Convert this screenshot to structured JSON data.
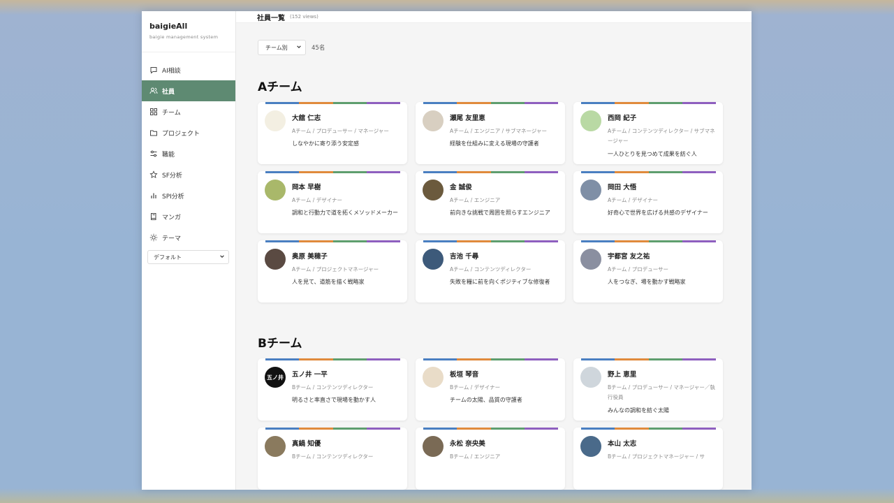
{
  "app": {
    "name": "baigieAll",
    "subtitle": "baigie management system"
  },
  "sidebar": {
    "items": [
      {
        "label": "AI相談",
        "icon": "chat-icon",
        "active": false
      },
      {
        "label": "社員",
        "icon": "users-icon",
        "active": true
      },
      {
        "label": "チーム",
        "icon": "grid-icon",
        "active": false
      },
      {
        "label": "プロジェクト",
        "icon": "folder-icon",
        "active": false
      },
      {
        "label": "職能",
        "icon": "sliders-icon",
        "active": false
      },
      {
        "label": "SF分析",
        "icon": "star-icon",
        "active": false
      },
      {
        "label": "SPI分析",
        "icon": "bar-chart-icon",
        "active": false
      },
      {
        "label": "マンガ",
        "icon": "book-icon",
        "active": false
      },
      {
        "label": "テーマ",
        "icon": "sun-icon",
        "active": false
      }
    ],
    "theme_value": "デフォルト"
  },
  "header": {
    "title": "社員一覧",
    "views": "(152 views)"
  },
  "filter": {
    "selected": "チーム別",
    "count": "45名"
  },
  "stripe_colors": [
    "#4a7fc1",
    "#e08a3c",
    "#5e9e6e",
    "#8e5fbf"
  ],
  "teams": [
    {
      "title": "Aチーム",
      "members": [
        {
          "name": "大舘 仁志",
          "role": "Aチーム / プロデューサー / マネージャー",
          "desc": "しなやかに寄り添う安定感",
          "avatar_color": "#f3efe2"
        },
        {
          "name": "瀬尾 友里恵",
          "role": "Aチーム / エンジニア / サブマネージャー",
          "desc": "経験を仕組みに変える現場の守護者",
          "avatar_color": "#d8cfc1"
        },
        {
          "name": "西岡 紀子",
          "role": "Aチーム / コンテンツディレクター / サブマネージャー",
          "desc": "一人ひとりを見つめて成果を紡ぐ人",
          "avatar_color": "#b9d9a4"
        },
        {
          "name": "岡本 早樹",
          "role": "Aチーム / デザイナー",
          "desc": "調和と行動力で道を拓くメソッドメーカー",
          "avatar_color": "#a9b86a"
        },
        {
          "name": "金 誠俊",
          "role": "Aチーム / エンジニア",
          "desc": "前向きな挑戦で周囲を照らすエンジニア",
          "avatar_color": "#6b5a3d"
        },
        {
          "name": "岡田 大悟",
          "role": "Aチーム / デザイナー",
          "desc": "好奇心で世界を広げる共感のデザイナー",
          "avatar_color": "#7f8fa6"
        },
        {
          "name": "奥原 美穂子",
          "role": "Aチーム / プロジェクトマネージャー",
          "desc": "人を見て、道筋を描く戦略家",
          "avatar_color": "#5a4a42"
        },
        {
          "name": "吉池 千尋",
          "role": "Aチーム / コンテンツディレクター",
          "desc": "失敗を糧に前を向くポジティブな修復者",
          "avatar_color": "#3d5a7a"
        },
        {
          "name": "宇都宮 友之祐",
          "role": "Aチーム / プロデューサー",
          "desc": "人をつなぎ、場を動かす戦略家",
          "avatar_color": "#8a8fa0"
        }
      ]
    },
    {
      "title": "Bチーム",
      "members": [
        {
          "name": "五ノ井 一平",
          "role": "Bチーム / コンテンツディレクター",
          "desc": "明るさと率直さで現場を動かす人",
          "avatar_color": "#111111",
          "avatar_text": "五ノ井"
        },
        {
          "name": "板垣 琴音",
          "role": "Bチーム / デザイナー",
          "desc": "チームの太陽、品質の守護者",
          "avatar_color": "#e9dcc8"
        },
        {
          "name": "野上 恵里",
          "role": "Bチーム / プロデューサー / マネージャー／執行役員",
          "desc": "みんなの調和を紡ぐ太陽",
          "avatar_color": "#cfd6dc"
        },
        {
          "name": "真鍋 知優",
          "role": "Bチーム / コンテンツディレクター",
          "desc": "",
          "avatar_color": "#8a7a5e"
        },
        {
          "name": "永松 奈央美",
          "role": "Bチーム / エンジニア",
          "desc": "",
          "avatar_color": "#7a6a55"
        },
        {
          "name": "本山 太志",
          "role": "Bチーム / プロジェクトマネージャー / サ",
          "desc": "",
          "avatar_color": "#4a6a8a"
        }
      ]
    }
  ]
}
